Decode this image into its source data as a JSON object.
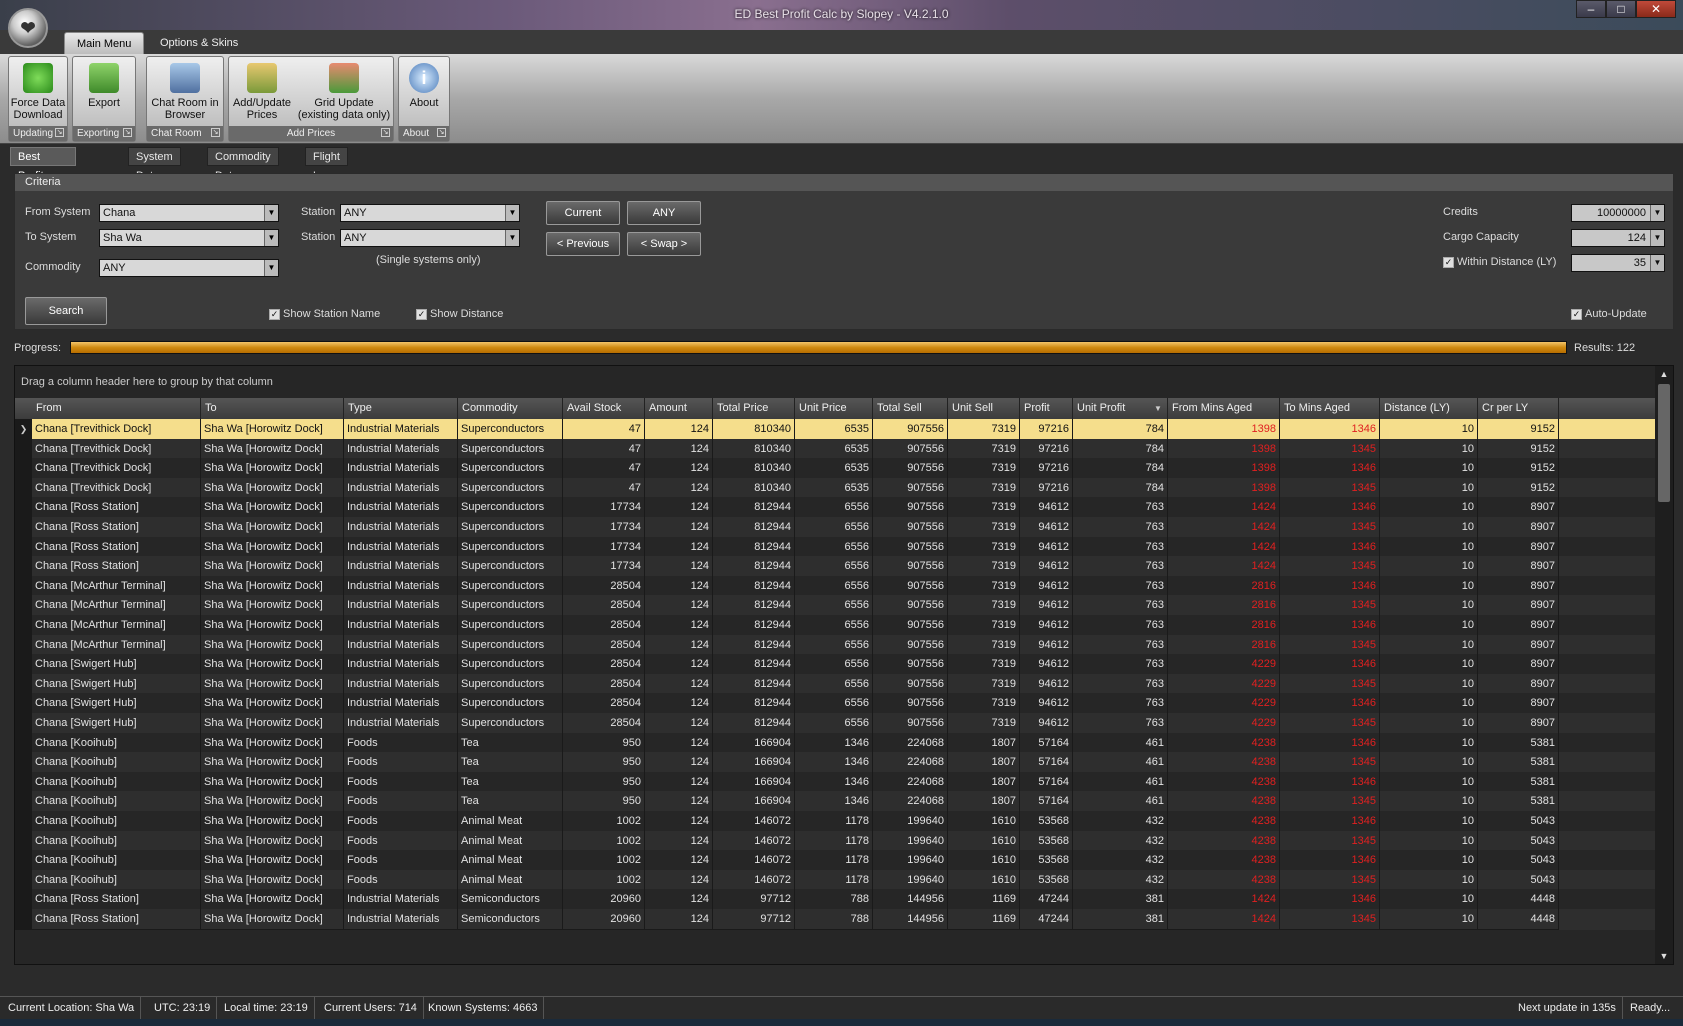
{
  "window": {
    "title": "ED Best Profit Calc by Slopey - V4.2.1.0"
  },
  "ribbon": {
    "tabs": [
      "Main Menu",
      "Options & Skins"
    ],
    "groups": [
      {
        "label": "Updating",
        "buttons": [
          {
            "label": "Force Data Download",
            "icon": "download-icon"
          }
        ]
      },
      {
        "label": "Exporting",
        "buttons": [
          {
            "label": "Export",
            "icon": "export-icon"
          }
        ]
      },
      {
        "label": "Chat Room",
        "buttons": [
          {
            "label": "Chat Room in Browser",
            "icon": "chat-icon"
          }
        ]
      },
      {
        "label": "Add Prices",
        "buttons": [
          {
            "label": "Add/Update Prices",
            "icon": "add-prices-icon"
          },
          {
            "label": "Grid Update (existing data only)",
            "icon": "grid-update-icon"
          }
        ]
      },
      {
        "label": "About",
        "buttons": [
          {
            "label": "About",
            "icon": "info-icon"
          }
        ]
      }
    ]
  },
  "doc_tabs": [
    "Best Profit Calculator",
    "System Data",
    "Commodity Data",
    "Flight Log"
  ],
  "criteria": {
    "header": "Criteria",
    "from_system_label": "From System",
    "from_system": "Chana",
    "to_system_label": "To System",
    "to_system": "Sha Wa",
    "commodity_label": "Commodity",
    "commodity": "ANY",
    "station_label": "Station",
    "from_station": "ANY",
    "to_station": "ANY",
    "single_note": "(Single systems only)",
    "btn_current": "Current",
    "btn_any": "ANY",
    "btn_previous": "< Previous",
    "btn_swap": "< Swap >",
    "credits_label": "Credits",
    "credits": "10000000",
    "cargo_label": "Cargo Capacity",
    "cargo": "124",
    "within_label": "Within Distance (LY)",
    "within": "35",
    "search_btn": "Search",
    "show_station": "Show Station Name",
    "show_distance": "Show Distance",
    "auto_update": "Auto-Update"
  },
  "progress": {
    "label": "Progress:",
    "percent": 100,
    "results": "Results: 122"
  },
  "grid": {
    "group_hint": "Drag a column header here to group by that column",
    "columns": [
      "From",
      "To",
      "Type",
      "Commodity",
      "Avail Stock",
      "Amount",
      "Total Price",
      "Unit Price",
      "Total Sell",
      "Unit Sell",
      "Profit",
      "Unit Profit",
      "From Mins Aged",
      "To Mins Aged",
      "Distance (LY)",
      "Cr per LY"
    ],
    "rows": [
      [
        "Chana [Trevithick Dock]",
        "Sha Wa [Horowitz Dock]",
        "Industrial Materials",
        "Superconductors",
        "47",
        "124",
        "810340",
        "6535",
        "907556",
        "7319",
        "97216",
        "784",
        "1398",
        "1346",
        "10",
        "9152"
      ],
      [
        "Chana [Trevithick Dock]",
        "Sha Wa [Horowitz Dock]",
        "Industrial Materials",
        "Superconductors",
        "47",
        "124",
        "810340",
        "6535",
        "907556",
        "7319",
        "97216",
        "784",
        "1398",
        "1345",
        "10",
        "9152"
      ],
      [
        "Chana [Trevithick Dock]",
        "Sha Wa [Horowitz Dock]",
        "Industrial Materials",
        "Superconductors",
        "47",
        "124",
        "810340",
        "6535",
        "907556",
        "7319",
        "97216",
        "784",
        "1398",
        "1346",
        "10",
        "9152"
      ],
      [
        "Chana [Trevithick Dock]",
        "Sha Wa [Horowitz Dock]",
        "Industrial Materials",
        "Superconductors",
        "47",
        "124",
        "810340",
        "6535",
        "907556",
        "7319",
        "97216",
        "784",
        "1398",
        "1345",
        "10",
        "9152"
      ],
      [
        "Chana [Ross Station]",
        "Sha Wa [Horowitz Dock]",
        "Industrial Materials",
        "Superconductors",
        "17734",
        "124",
        "812944",
        "6556",
        "907556",
        "7319",
        "94612",
        "763",
        "1424",
        "1346",
        "10",
        "8907"
      ],
      [
        "Chana [Ross Station]",
        "Sha Wa [Horowitz Dock]",
        "Industrial Materials",
        "Superconductors",
        "17734",
        "124",
        "812944",
        "6556",
        "907556",
        "7319",
        "94612",
        "763",
        "1424",
        "1345",
        "10",
        "8907"
      ],
      [
        "Chana [Ross Station]",
        "Sha Wa [Horowitz Dock]",
        "Industrial Materials",
        "Superconductors",
        "17734",
        "124",
        "812944",
        "6556",
        "907556",
        "7319",
        "94612",
        "763",
        "1424",
        "1346",
        "10",
        "8907"
      ],
      [
        "Chana [Ross Station]",
        "Sha Wa [Horowitz Dock]",
        "Industrial Materials",
        "Superconductors",
        "17734",
        "124",
        "812944",
        "6556",
        "907556",
        "7319",
        "94612",
        "763",
        "1424",
        "1345",
        "10",
        "8907"
      ],
      [
        "Chana [McArthur Terminal]",
        "Sha Wa [Horowitz Dock]",
        "Industrial Materials",
        "Superconductors",
        "28504",
        "124",
        "812944",
        "6556",
        "907556",
        "7319",
        "94612",
        "763",
        "2816",
        "1346",
        "10",
        "8907"
      ],
      [
        "Chana [McArthur Terminal]",
        "Sha Wa [Horowitz Dock]",
        "Industrial Materials",
        "Superconductors",
        "28504",
        "124",
        "812944",
        "6556",
        "907556",
        "7319",
        "94612",
        "763",
        "2816",
        "1345",
        "10",
        "8907"
      ],
      [
        "Chana [McArthur Terminal]",
        "Sha Wa [Horowitz Dock]",
        "Industrial Materials",
        "Superconductors",
        "28504",
        "124",
        "812944",
        "6556",
        "907556",
        "7319",
        "94612",
        "763",
        "2816",
        "1346",
        "10",
        "8907"
      ],
      [
        "Chana [McArthur Terminal]",
        "Sha Wa [Horowitz Dock]",
        "Industrial Materials",
        "Superconductors",
        "28504",
        "124",
        "812944",
        "6556",
        "907556",
        "7319",
        "94612",
        "763",
        "2816",
        "1345",
        "10",
        "8907"
      ],
      [
        "Chana [Swigert Hub]",
        "Sha Wa [Horowitz Dock]",
        "Industrial Materials",
        "Superconductors",
        "28504",
        "124",
        "812944",
        "6556",
        "907556",
        "7319",
        "94612",
        "763",
        "4229",
        "1346",
        "10",
        "8907"
      ],
      [
        "Chana [Swigert Hub]",
        "Sha Wa [Horowitz Dock]",
        "Industrial Materials",
        "Superconductors",
        "28504",
        "124",
        "812944",
        "6556",
        "907556",
        "7319",
        "94612",
        "763",
        "4229",
        "1345",
        "10",
        "8907"
      ],
      [
        "Chana [Swigert Hub]",
        "Sha Wa [Horowitz Dock]",
        "Industrial Materials",
        "Superconductors",
        "28504",
        "124",
        "812944",
        "6556",
        "907556",
        "7319",
        "94612",
        "763",
        "4229",
        "1346",
        "10",
        "8907"
      ],
      [
        "Chana [Swigert Hub]",
        "Sha Wa [Horowitz Dock]",
        "Industrial Materials",
        "Superconductors",
        "28504",
        "124",
        "812944",
        "6556",
        "907556",
        "7319",
        "94612",
        "763",
        "4229",
        "1345",
        "10",
        "8907"
      ],
      [
        "Chana [Kooihub]",
        "Sha Wa [Horowitz Dock]",
        "Foods",
        "Tea",
        "950",
        "124",
        "166904",
        "1346",
        "224068",
        "1807",
        "57164",
        "461",
        "4238",
        "1346",
        "10",
        "5381"
      ],
      [
        "Chana [Kooihub]",
        "Sha Wa [Horowitz Dock]",
        "Foods",
        "Tea",
        "950",
        "124",
        "166904",
        "1346",
        "224068",
        "1807",
        "57164",
        "461",
        "4238",
        "1345",
        "10",
        "5381"
      ],
      [
        "Chana [Kooihub]",
        "Sha Wa [Horowitz Dock]",
        "Foods",
        "Tea",
        "950",
        "124",
        "166904",
        "1346",
        "224068",
        "1807",
        "57164",
        "461",
        "4238",
        "1346",
        "10",
        "5381"
      ],
      [
        "Chana [Kooihub]",
        "Sha Wa [Horowitz Dock]",
        "Foods",
        "Tea",
        "950",
        "124",
        "166904",
        "1346",
        "224068",
        "1807",
        "57164",
        "461",
        "4238",
        "1345",
        "10",
        "5381"
      ],
      [
        "Chana [Kooihub]",
        "Sha Wa [Horowitz Dock]",
        "Foods",
        "Animal Meat",
        "1002",
        "124",
        "146072",
        "1178",
        "199640",
        "1610",
        "53568",
        "432",
        "4238",
        "1346",
        "10",
        "5043"
      ],
      [
        "Chana [Kooihub]",
        "Sha Wa [Horowitz Dock]",
        "Foods",
        "Animal Meat",
        "1002",
        "124",
        "146072",
        "1178",
        "199640",
        "1610",
        "53568",
        "432",
        "4238",
        "1345",
        "10",
        "5043"
      ],
      [
        "Chana [Kooihub]",
        "Sha Wa [Horowitz Dock]",
        "Foods",
        "Animal Meat",
        "1002",
        "124",
        "146072",
        "1178",
        "199640",
        "1610",
        "53568",
        "432",
        "4238",
        "1346",
        "10",
        "5043"
      ],
      [
        "Chana [Kooihub]",
        "Sha Wa [Horowitz Dock]",
        "Foods",
        "Animal Meat",
        "1002",
        "124",
        "146072",
        "1178",
        "199640",
        "1610",
        "53568",
        "432",
        "4238",
        "1345",
        "10",
        "5043"
      ],
      [
        "Chana [Ross Station]",
        "Sha Wa [Horowitz Dock]",
        "Industrial Materials",
        "Semiconductors",
        "20960",
        "124",
        "97712",
        "788",
        "144956",
        "1169",
        "47244",
        "381",
        "1424",
        "1346",
        "10",
        "4448"
      ],
      [
        "Chana [Ross Station]",
        "Sha Wa [Horowitz Dock]",
        "Industrial Materials",
        "Semiconductors",
        "20960",
        "124",
        "97712",
        "788",
        "144956",
        "1169",
        "47244",
        "381",
        "1424",
        "1345",
        "10",
        "4448"
      ]
    ]
  },
  "status": {
    "location": "Current Location: Sha Wa",
    "utc": "UTC: 23:19",
    "local": "Local time: 23:19",
    "users": "Current Users: 714",
    "systems": "Known Systems: 4663",
    "next_update": "Next update in 135s",
    "ready": "Ready..."
  },
  "colors": {
    "selected_row": "#f5de8c",
    "aged_red": "#e02020",
    "progress": "#d08a10"
  }
}
